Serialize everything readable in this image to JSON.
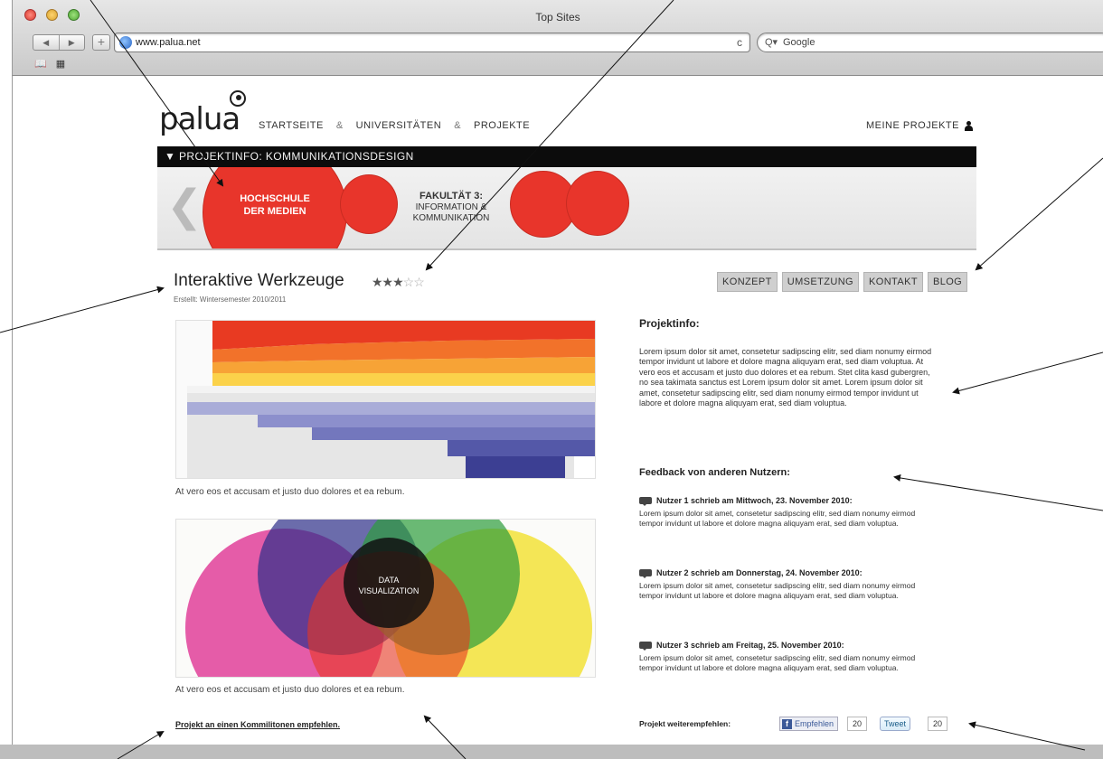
{
  "browser": {
    "window_title": "Top Sites",
    "nav_back": "◀",
    "nav_forward": "▶",
    "new_tab": "+",
    "url": "www.palua.net",
    "reload": "c",
    "search_placeholder": "Google",
    "search_prefix": "Q▾",
    "bookmarks": [
      "📖",
      "▦"
    ]
  },
  "site": {
    "logo": "palua",
    "nav": [
      "STARTSEITE",
      "UNIVERSITÄTEN",
      "PROJEKTE"
    ],
    "nav_separator": "&",
    "my_projects": "MEINE PROJEKTE",
    "project_bar": "▼ PROJEKTINFO: KOMMUNIKATIONSDESIGN",
    "banner": {
      "left_arrow": "❮",
      "school_line1": "HOCHSCHULE",
      "school_line2": "DER MEDIEN",
      "faculty_title": "FAKULTÄT 3:",
      "faculty_line1": "INFORMATION &",
      "faculty_line2": "KOMMUNIKATION"
    }
  },
  "project": {
    "title": "Interaktive Werkzeuge",
    "rating": 3,
    "rating_max": 5,
    "stars_on": "★★★",
    "stars_off": "☆☆",
    "created": "Erstellt: Wintersemester 2010/2011",
    "tabs": [
      "KONZEPT",
      "UMSETZUNG",
      "KONTAKT",
      "BLOG"
    ],
    "caption1": "At vero eos et accusam et justo duo dolores et ea rebum.",
    "caption2": "At vero eos et accusam et justo duo dolores et ea rebum.",
    "recommend_link": "Projekt an einen Kommilitonen empfehlen.",
    "venn_center_line1": "DATA",
    "venn_center_line2": "VISUALIZATION"
  },
  "info": {
    "heading": "Projektinfo:",
    "text": "Lorem ipsum dolor sit amet, consetetur sadipscing elitr, sed diam nonumy eirmod tempor invidunt ut labore et dolore magna aliquyam erat, sed diam voluptua. At vero eos et accusam et justo duo dolores et ea rebum. Stet clita kasd gubergren, no sea takimata sanctus est Lorem ipsum dolor sit amet. Lorem ipsum dolor sit amet, consetetur sadipscing elitr, sed diam nonumy eirmod tempor invidunt ut labore et dolore magna aliquyam erat, sed diam voluptua."
  },
  "feedback": {
    "heading": "Feedback von anderen Nutzern:",
    "comments": [
      {
        "author": "Nutzer 1 schrieb am Mittwoch, 23. November 2010:",
        "text": "Lorem ipsum dolor sit amet, consetetur sadipscing elitr, sed diam nonumy eirmod tempor invidunt ut labore et dolore magna aliquyam erat, sed diam voluptua."
      },
      {
        "author": "Nutzer 2 schrieb am Donnerstag, 24. November 2010:",
        "text": "Lorem ipsum dolor sit amet, consetetur sadipscing elitr, sed diam nonumy eirmod tempor invidunt ut labore et dolore magna aliquyam erat, sed diam voluptua."
      },
      {
        "author": "Nutzer 3 schrieb am Freitag, 25. November 2010:",
        "text": "Lorem ipsum dolor sit amet, consetetur sadipscing elitr, sed diam nonumy eirmod tempor invidunt ut labore et dolore magna aliquyam erat, sed diam voluptua."
      }
    ]
  },
  "share": {
    "label": "Projekt weiterempfehlen:",
    "facebook_label": "Empfehlen",
    "facebook_icon": "f",
    "facebook_count": "20",
    "tweet_label": "Tweet",
    "tweet_count": "20"
  },
  "colors": {
    "accent_red": "#e8352b",
    "project_bar": "#0c0c0c",
    "tab_bg": "#cfcfcf"
  }
}
